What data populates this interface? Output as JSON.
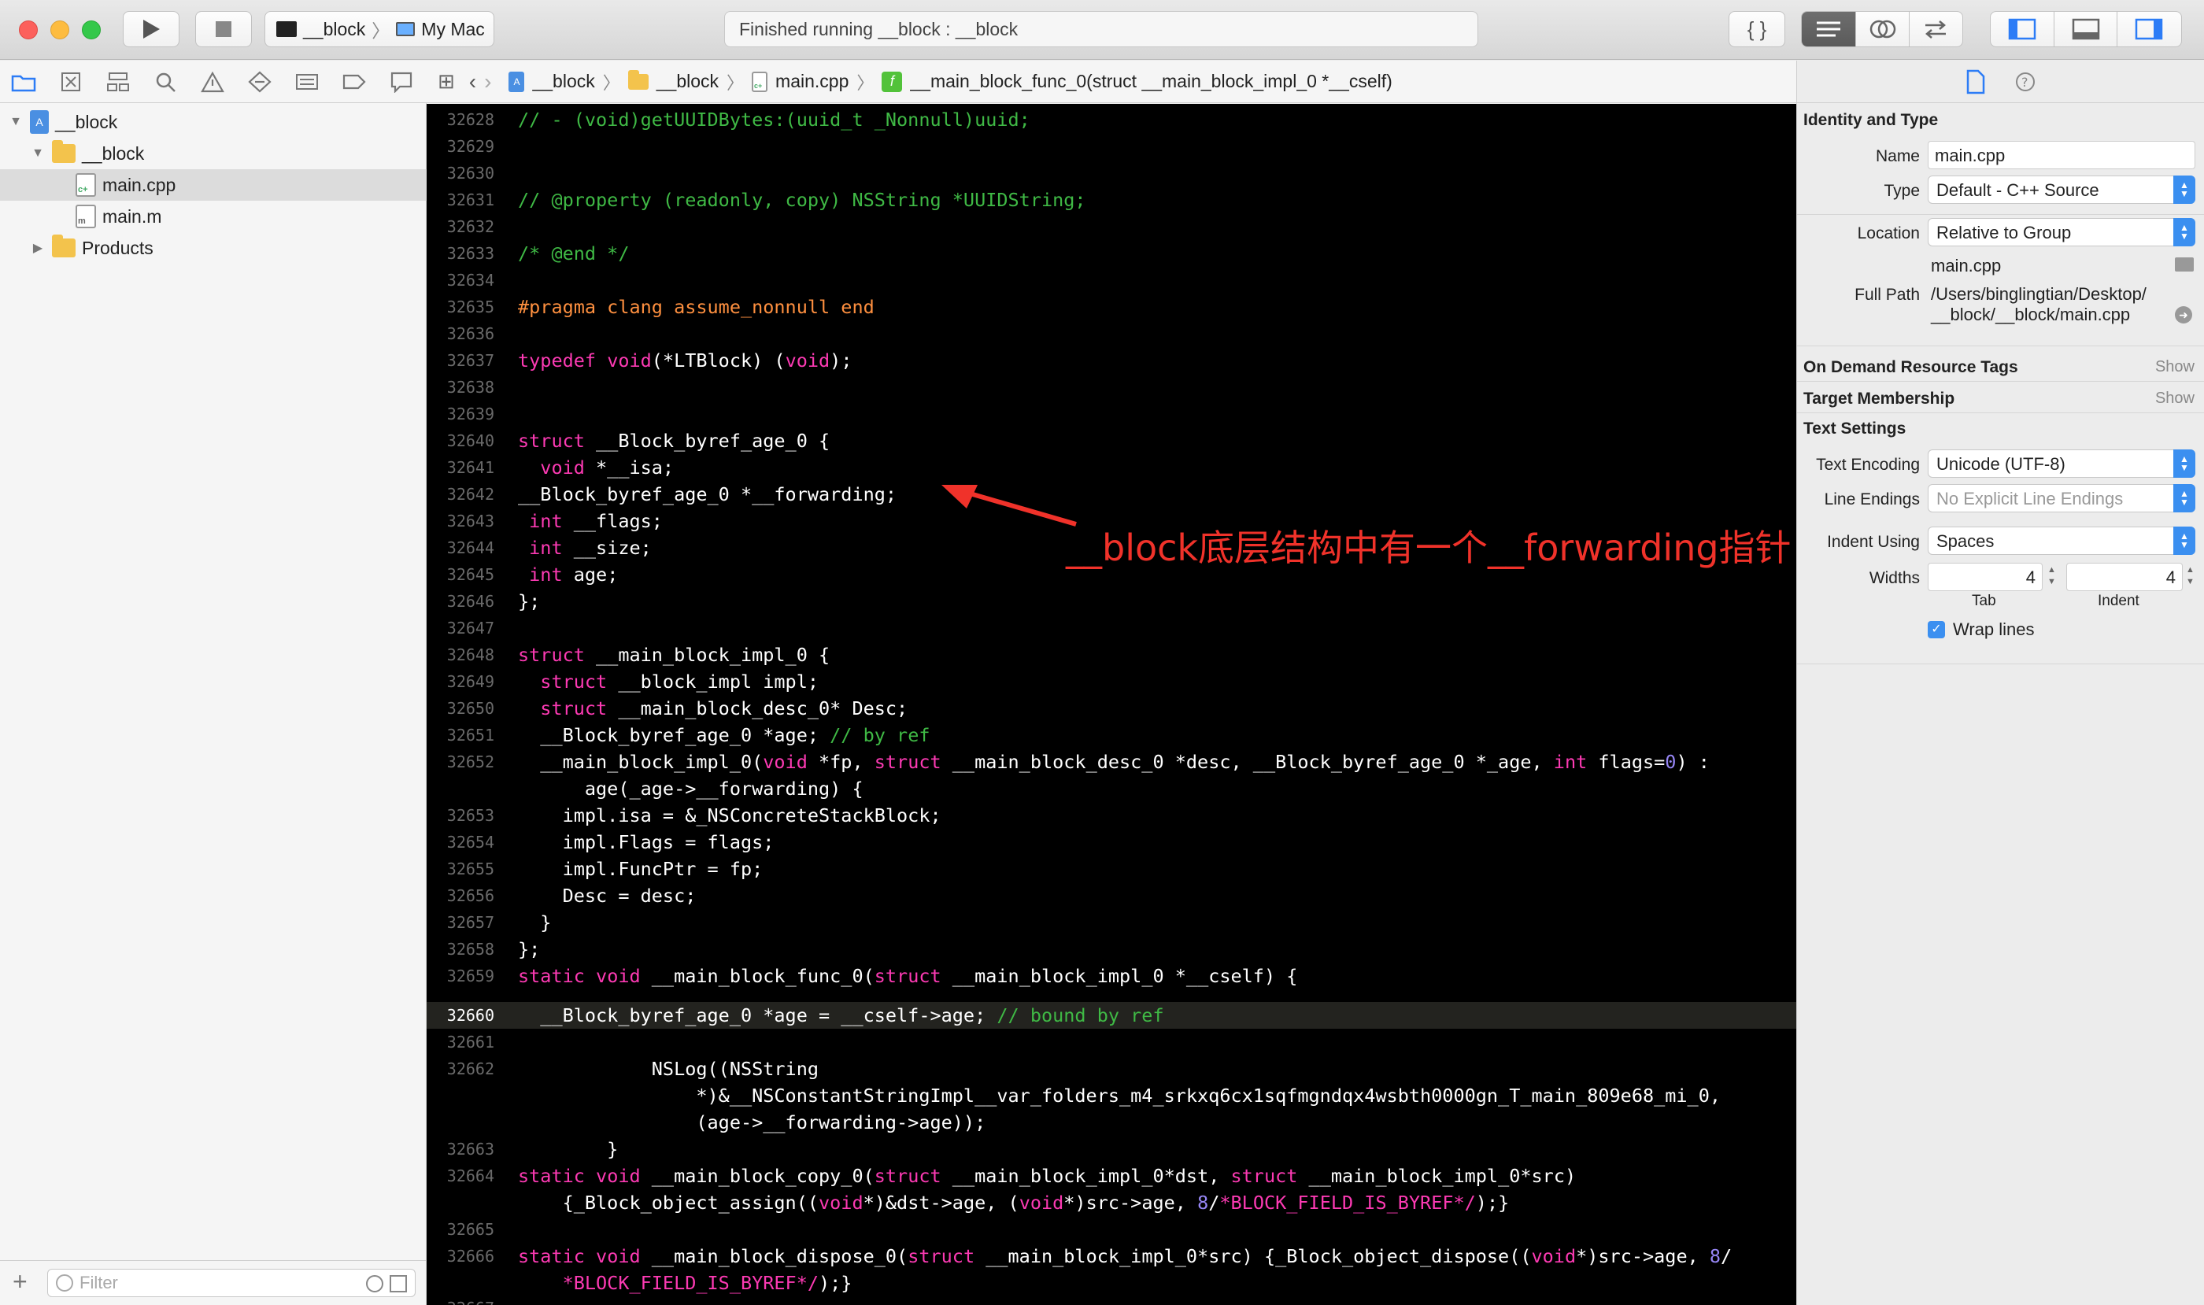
{
  "toolbar": {
    "scheme_target": "__block",
    "scheme_device": "My Mac",
    "status": "Finished running __block : __block"
  },
  "navigator": {
    "filter_placeholder": "Filter",
    "items": [
      {
        "label": "__block",
        "kind": "project",
        "level": 0,
        "expanded": true
      },
      {
        "label": "__block",
        "kind": "folder",
        "level": 1,
        "expanded": true
      },
      {
        "label": "main.cpp",
        "kind": "cpp",
        "level": 2,
        "selected": true
      },
      {
        "label": "main.m",
        "kind": "m",
        "level": 2
      },
      {
        "label": "Products",
        "kind": "folder",
        "level": 1,
        "expanded": false
      }
    ]
  },
  "jumpbar": {
    "crumbs": [
      "__block",
      "__block",
      "main.cpp",
      "__main_block_func_0(struct __main_block_impl_0 *__cself)"
    ]
  },
  "editor": {
    "current_line": "32660",
    "annotation": "__block底层结构中有一个__forwarding指针"
  },
  "inspector": {
    "identity_title": "Identity and Type",
    "name_label": "Name",
    "name_value": "main.cpp",
    "type_label": "Type",
    "type_value": "Default - C++ Source",
    "location_label": "Location",
    "location_value": "Relative to Group",
    "location_file": "main.cpp",
    "fullpath_label": "Full Path",
    "fullpath_line1": "/Users/binglingtian/Desktop/",
    "fullpath_line2": "__block/__block/main.cpp",
    "odr_title": "On Demand Resource Tags",
    "target_title": "Target Membership",
    "show_label": "Show",
    "text_settings_title": "Text Settings",
    "encoding_label": "Text Encoding",
    "encoding_value": "Unicode (UTF-8)",
    "line_endings_label": "Line Endings",
    "line_endings_value": "No Explicit Line Endings",
    "indent_using_label": "Indent Using",
    "indent_using_value": "Spaces",
    "widths_label": "Widths",
    "tab_value": "4",
    "indent_value": "4",
    "tab_caption": "Tab",
    "indent_caption": "Indent",
    "wrap_label": "Wrap lines"
  }
}
